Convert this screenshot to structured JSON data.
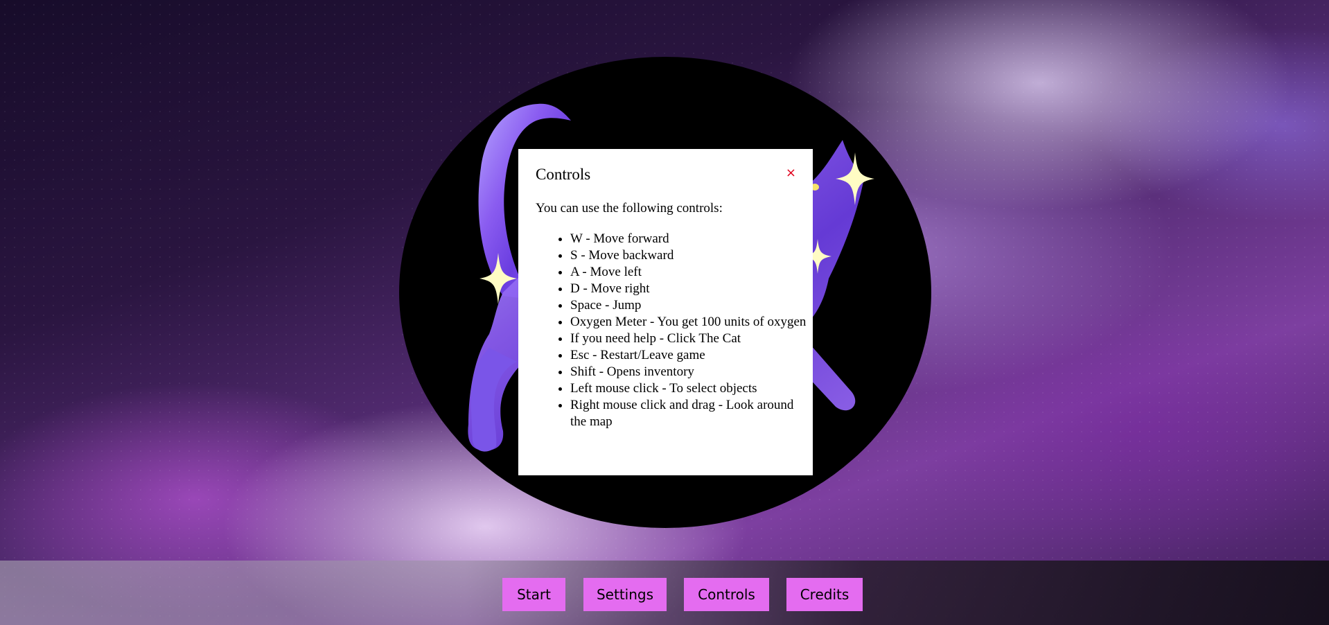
{
  "menu": {
    "start_label": "Start",
    "settings_label": "Settings",
    "controls_label": "Controls",
    "credits_label": "Credits"
  },
  "modal": {
    "title": "Controls",
    "close_icon": "×",
    "intro": "You can use the following controls:",
    "items": [
      "W - Move forward",
      "S - Move backward",
      "A - Move left",
      "D - Move right",
      "Space - Jump",
      "Oxygen Meter - You get 100 units of oxygen",
      "If you need help - Click The Cat",
      "Esc - Restart/Leave game",
      "Shift - Opens inventory",
      "Left mouse click - To select objects",
      "Right mouse click and drag - Look around the map"
    ]
  },
  "colors": {
    "button": "#e46cf0",
    "close": "#e0001b",
    "sparkle": "#fffcc4"
  },
  "icons": {
    "logo": "galaxy-cat-logo",
    "sparkle": "four-point-star-icon"
  }
}
